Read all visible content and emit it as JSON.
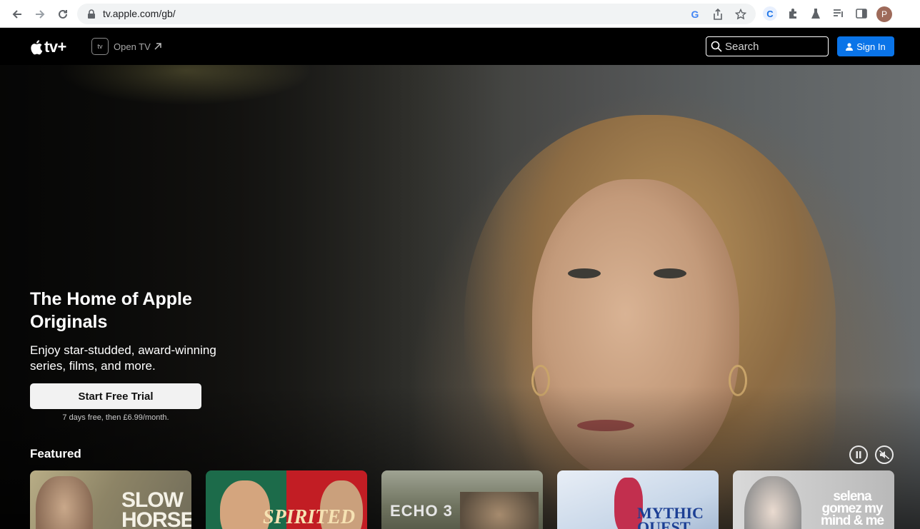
{
  "browser": {
    "url": "tv.apple.com/gb/",
    "profile_initial": "P"
  },
  "header": {
    "logo_text": "tv+",
    "open_tv_icon_text": "tv",
    "open_tv_label": "Open TV",
    "search_placeholder": "Search",
    "sign_in_label": "Sign In"
  },
  "hero": {
    "title": "The Home of Apple Originals",
    "subtitle": "Enjoy star-studded, award-winning series, films, and more.",
    "cta_label": "Start Free Trial",
    "cta_note": "7 days free, then £6.99/month."
  },
  "featured": {
    "heading": "Featured",
    "cards": [
      {
        "title": "SLOW HORSES"
      },
      {
        "title": "SPIRITED"
      },
      {
        "title": "ECHO 3"
      },
      {
        "title": "MYTHIC QUEST"
      },
      {
        "title": "selena gomez my mind & me"
      }
    ]
  },
  "colors": {
    "accent": "#0a74e8",
    "background": "#000000"
  }
}
